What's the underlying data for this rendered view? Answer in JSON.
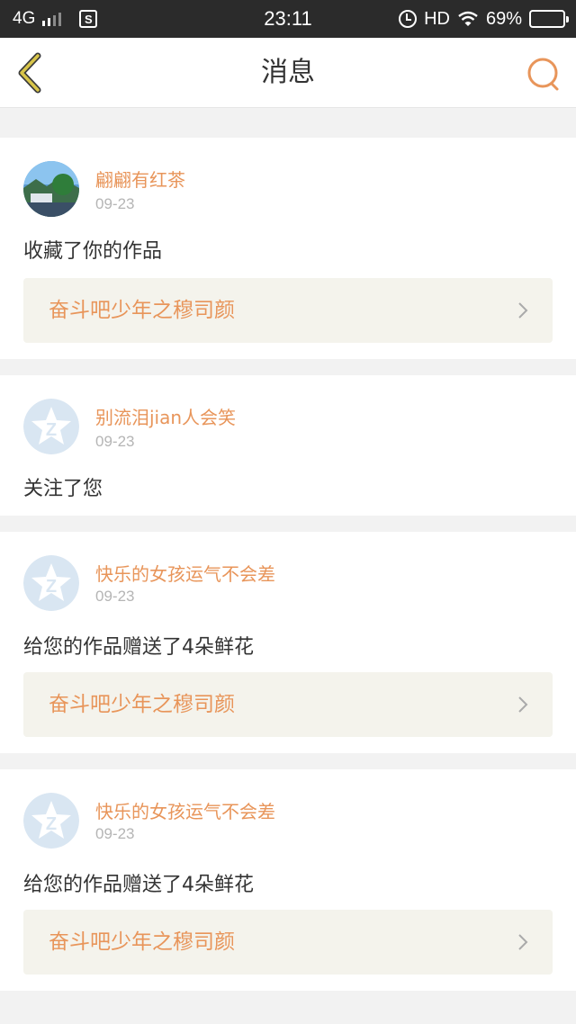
{
  "status_bar": {
    "network": "4G",
    "time": "23:11",
    "hd": "HD",
    "battery_percent": "69%",
    "battery_level": 0.69
  },
  "nav": {
    "title": "消息",
    "back_icon": "chevron-left-icon",
    "search_icon": "search-icon"
  },
  "messages": [
    {
      "user": "翩翩有红茶",
      "date": "09-23",
      "action": "收藏了你的作品",
      "work": "奋斗吧少年之穆司颜",
      "avatar": "landscape-photo"
    },
    {
      "user": "别流泪jian人会笑",
      "date": "09-23",
      "action": "关注了您",
      "work": null,
      "avatar": "default-avatar"
    },
    {
      "user": "快乐的女孩运气不会差",
      "date": "09-23",
      "action": "给您的作品赠送了4朵鲜花",
      "work": "奋斗吧少年之穆司颜",
      "avatar": "default-avatar"
    },
    {
      "user": "快乐的女孩运气不会差",
      "date": "09-23",
      "action": "给您的作品赠送了4朵鲜花",
      "work": "奋斗吧少年之穆司颜",
      "avatar": "default-avatar"
    }
  ],
  "colors": {
    "accent": "#e8955a",
    "back_arrow": "#c8b43c",
    "link_bg": "#f4f3ec",
    "page_bg": "#f2f2f2"
  }
}
